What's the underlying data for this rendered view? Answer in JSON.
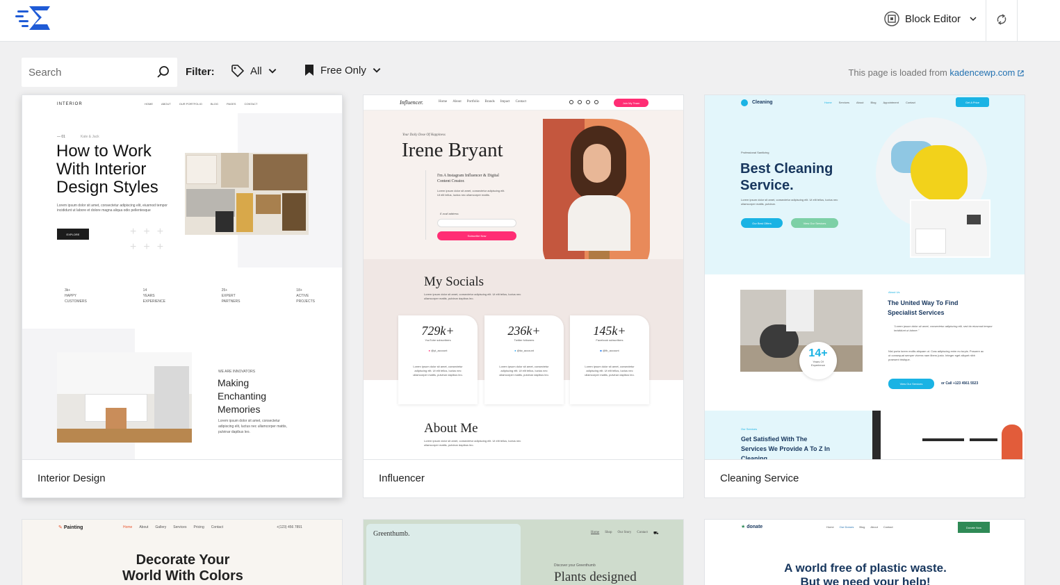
{
  "topbar": {
    "editor_label": "Block Editor"
  },
  "filters": {
    "search_placeholder": "Search",
    "filter_label": "Filter:",
    "category_value": "All",
    "license_value": "Free Only",
    "loaded_prefix": "This page is loaded from ",
    "loaded_link": "kadencewp.com"
  },
  "colors": {
    "accent": "#2271b1",
    "brand": "#1f5bd6",
    "pink": "#ff2d74",
    "cleaning_blue": "#1ab3e4",
    "green": "#2f8a56"
  },
  "cards": [
    {
      "title": "Interior Design",
      "preview": {
        "brand": "INTERIOR",
        "nav": [
          "HOME",
          "ABOUT",
          "OUR PORTFOLIO",
          "BLOG",
          "PAGES",
          "CONTACT"
        ],
        "eyebrow": "— 01",
        "byline": "Kate & Jack",
        "headline_1": "How to Work",
        "headline_2": "With Interior",
        "headline_3": "Design Styles",
        "body": "Lorem ipsum dolor sit amet, consectetur adipiscing elit, eiusmod tempor incididunt ut labore et dolore magna aliqua odio pellentesque",
        "cta": "EXPLORE",
        "stats": [
          {
            "num": "3k+",
            "l1": "HAPPY",
            "l2": "CUSTOMERS"
          },
          {
            "num": "14",
            "l1": "YEARS",
            "l2": "EXPERIENCE"
          },
          {
            "num": "25+",
            "l1": "EXPERT",
            "l2": "PARTNERS"
          },
          {
            "num": "18+",
            "l1": "ACTIVE",
            "l2": "PROJECTS"
          }
        ],
        "eyebrow2": "WE ARE INNOVATORS",
        "h2_1": "Making",
        "h2_2": "Enchanting",
        "h2_3": "Memories",
        "body2": "Lorem ipsum dolor sit amet, consectetur adipiscing elit, luctus nec ullamcorper mattis, pulvinar dapibus leo."
      }
    },
    {
      "title": "Influencer",
      "preview": {
        "brand": "Influencer.",
        "nav": [
          "Home",
          "About",
          "Portfolio",
          "Brands",
          "Impact",
          "Contact"
        ],
        "cta": "Join My Team",
        "eyebrow": "Your Daily Dose Of Happiness",
        "name": "Irene Bryant",
        "intro_1": "I'm A Instagram Influencer & Digital",
        "intro_2": "Content Creator.",
        "body": "Lorem ipsum dolor sit amet, consectetur adipiscing elit. Ut elit tellus, luctus nec ullamcorper mattis.",
        "email_label": "E-mail address",
        "subscribe": "Subscribe Now",
        "socials_title": "My Socials",
        "socials_body": "Lorem ipsum dolor sit amet, consectetur adipiscing elit. Ut elit tellus, luctus nec ullamcorper mattis, pulvinar dapibus leo.",
        "stats": [
          {
            "num": "729k+",
            "label": "YouTube subscribers",
            "handle": "@yt_account"
          },
          {
            "num": "236k+",
            "label": "Twitter followers",
            "handle": "@tw_account"
          },
          {
            "num": "145k+",
            "label": "Facebook subscribers",
            "handle": "@fb_account"
          }
        ],
        "stat_body": "Lorem ipsum dolor sit amet, consectetur adipiscing elit. Ut elit tellus, luctus nec ullamcorper mattis, pulvinar dapibus leo.",
        "about_title": "About Me",
        "about_body": "Lorem ipsum dolor sit amet, consectetur adipiscing elit. Ut elit tellus, luctus nec ullamcorper mattis, pulvinar dapibus leo."
      }
    },
    {
      "title": "Cleaning Service",
      "preview": {
        "brand": "Cleaning",
        "nav": [
          "Home",
          "Services",
          "About",
          "Blog",
          "Appointment",
          "Contact"
        ],
        "cta": "Get A Price",
        "eyebrow": "Professional Sanitizing",
        "headline_1": "Best Cleaning",
        "headline_2": "Service.",
        "body": "Lorem ipsum dolor sit amet, consectetur adipiscing elit. Ut elit tellus, luctus nec ullamcorper mattis, pulvinar.",
        "btn1": "Our Best Offers",
        "btn2": "View Our Services",
        "about_eyebrow": "About Us",
        "about_h1": "The United Way To Find",
        "about_h2": "Specialist Services",
        "quote": "\"Lorem ipsum dolor sit amet, consectetur adipiscing elit, sed do eiusmod tempor incididunt ut labore.\"",
        "about_body": "Nisl porta lorem mollis aliquam ut. Cras adipiscing enim eu turpis. Posuere ac ut consequat semper viverra nam libero justo. Integer eget aliquet nibh praesent tristique.",
        "years_num": "14+",
        "years_l1": "Years Of",
        "years_l2": "Experience",
        "btn3": "View Our Services",
        "call": "or Call +123 4561 5523",
        "services_eyebrow": "Our Services",
        "services_h1": "Get Satisfied With The",
        "services_h2": "Services We Provide A To Z In",
        "services_h3": "Cleaning"
      }
    }
  ],
  "row2": [
    {
      "brand": "Painting",
      "nav": [
        "Home",
        "About",
        "Gallery",
        "Services",
        "Pricing",
        "Contact"
      ],
      "phone": "+(123) 456 7891",
      "headline_1": "Decorate Your",
      "headline_2": "World With Colors"
    },
    {
      "brand": "Greenthumb.",
      "nav": [
        "Home",
        "Shop",
        "Our Story",
        "Contact"
      ],
      "eyebrow": "Discover your Greenthumb",
      "headline": "Plants designed"
    },
    {
      "brand": "donate",
      "nav": [
        "Home",
        "Our Donors",
        "Blog",
        "About",
        "Contact"
      ],
      "cta": "Donate Now",
      "headline_1": "A world free of plastic waste.",
      "headline_2": "But we need your help!"
    }
  ]
}
